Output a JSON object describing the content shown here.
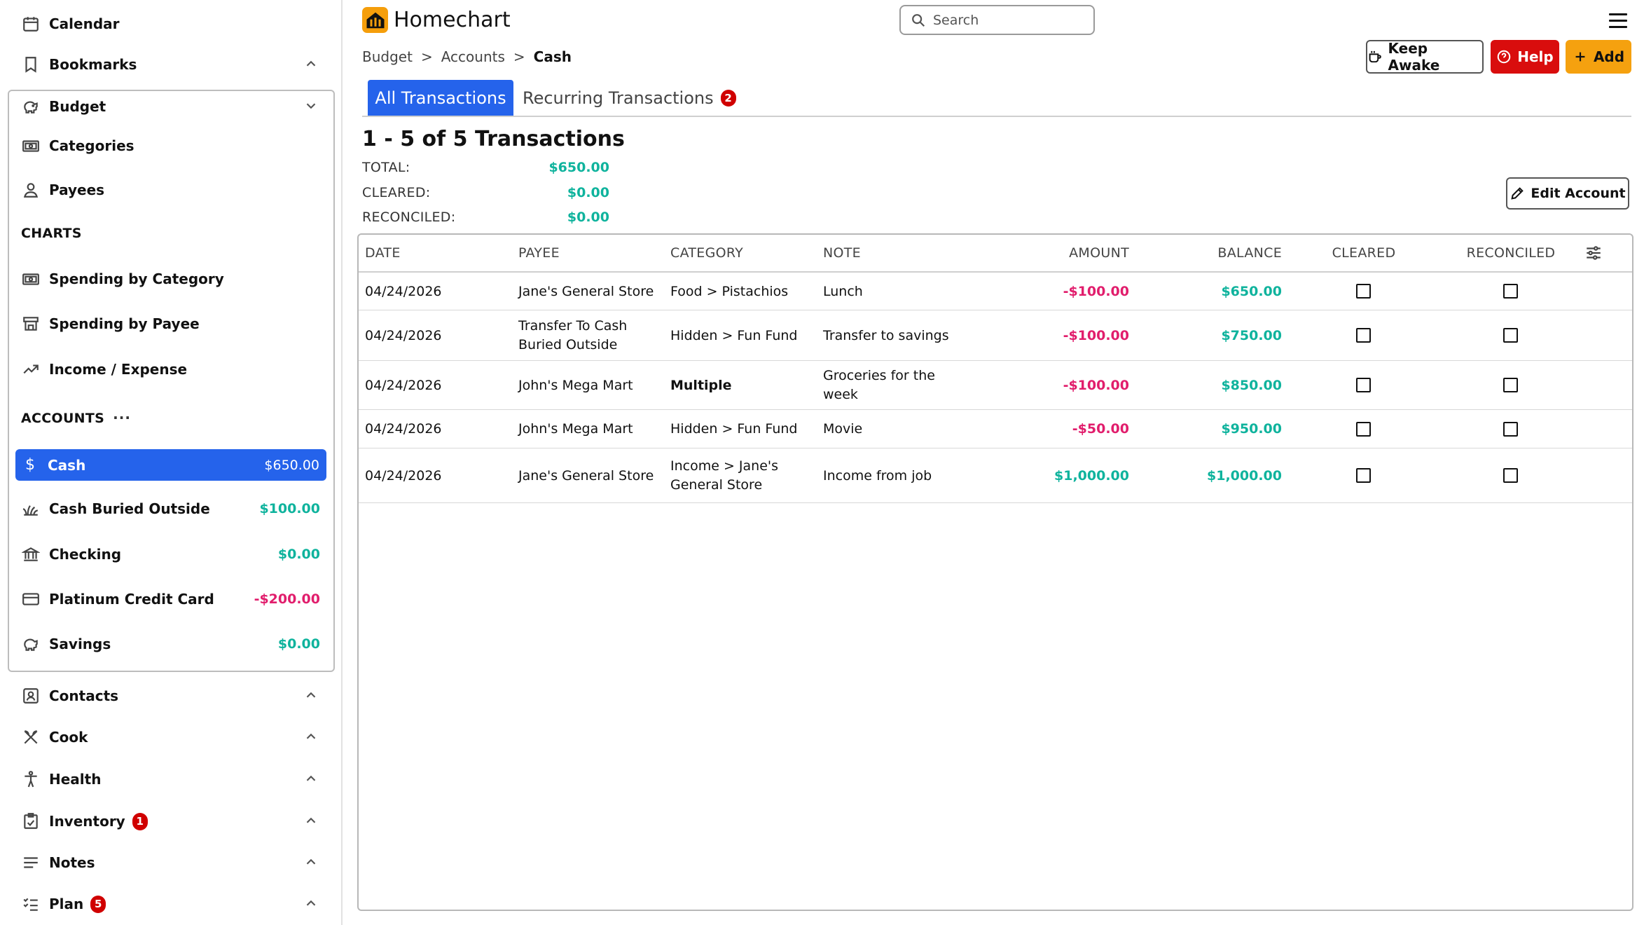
{
  "app": {
    "title": "Homechart"
  },
  "search": {
    "placeholder": "Search"
  },
  "sidebar": {
    "top_items": [
      {
        "label": "Calendar",
        "icon": "calendar-icon"
      },
      {
        "label": "Bookmarks",
        "icon": "bookmark-icon"
      }
    ],
    "budget": {
      "label": "Budget",
      "items": [
        {
          "label": "Categories",
          "icon": "categories-icon"
        },
        {
          "label": "Payees",
          "icon": "payee-icon"
        }
      ],
      "charts_title": "CHARTS",
      "charts": [
        {
          "label": "Spending by Category",
          "icon": "chart-category-icon"
        },
        {
          "label": "Spending by Payee",
          "icon": "store-icon"
        },
        {
          "label": "Income / Expense",
          "icon": "trend-icon"
        }
      ],
      "accounts_title": "ACCOUNTS",
      "accounts_more": "···",
      "accounts": [
        {
          "label": "Cash",
          "amount": "$650.00",
          "amount_color": "#ffffff",
          "icon": "dollar-icon",
          "active": true
        },
        {
          "label": "Cash Buried Outside",
          "amount": "$100.00",
          "amount_color": "#0fb39d",
          "icon": "grass-icon"
        },
        {
          "label": "Checking",
          "amount": "$0.00",
          "amount_color": "#0fb39d",
          "icon": "bank-icon"
        },
        {
          "label": "Platinum Credit Card",
          "amount": "-$200.00",
          "amount_color": "#e11d6c",
          "icon": "credit-card-icon"
        },
        {
          "label": "Savings",
          "amount": "$0.00",
          "amount_color": "#0fb39d",
          "icon": "piggy-bank-icon"
        }
      ]
    },
    "bottom_items": [
      {
        "label": "Contacts",
        "icon": "contacts-icon",
        "badge": ""
      },
      {
        "label": "Cook",
        "icon": "cook-icon",
        "badge": ""
      },
      {
        "label": "Health",
        "icon": "health-icon",
        "badge": ""
      },
      {
        "label": "Inventory",
        "icon": "inventory-icon",
        "badge": "1"
      },
      {
        "label": "Notes",
        "icon": "notes-icon",
        "badge": ""
      },
      {
        "label": "Plan",
        "icon": "plan-icon",
        "badge": "5"
      }
    ]
  },
  "breadcrumb": {
    "items": [
      "Budget",
      "Accounts",
      "Cash"
    ],
    "separator": ">"
  },
  "toolbar": {
    "keep_awake": "Keep Awake",
    "help": "Help",
    "add": "Add"
  },
  "tabs": [
    {
      "label": "All Transactions",
      "active": true
    },
    {
      "label": "Recurring Transactions",
      "badge": "2"
    }
  ],
  "summary": {
    "title": "1 - 5 of 5 Transactions",
    "rows": [
      {
        "label": "TOTAL:",
        "value": "$650.00"
      },
      {
        "label": "CLEARED:",
        "value": "$0.00"
      },
      {
        "label": "RECONCILED:",
        "value": "$0.00"
      }
    ],
    "edit_account": "Edit Account"
  },
  "table": {
    "columns": [
      "DATE",
      "PAYEE",
      "CATEGORY",
      "NOTE",
      "AMOUNT",
      "BALANCE",
      "CLEARED",
      "RECONCILED"
    ],
    "rows": [
      {
        "date": "04/24/2026",
        "payee": [
          "Jane's General Store"
        ],
        "category": [
          "Food > Pistachios"
        ],
        "category_bold": false,
        "note": [
          "Lunch"
        ],
        "amount": "-$100.00",
        "amount_color": "#e11d6c",
        "balance": "$650.00",
        "cleared": false,
        "reconciled": false
      },
      {
        "date": "04/24/2026",
        "payee": [
          "Transfer To Cash",
          "Buried Outside"
        ],
        "category": [
          "Hidden > Fun Fund"
        ],
        "category_bold": false,
        "note": [
          "Transfer to savings"
        ],
        "amount": "-$100.00",
        "amount_color": "#e11d6c",
        "balance": "$750.00",
        "cleared": false,
        "reconciled": false
      },
      {
        "date": "04/24/2026",
        "payee": [
          "John's Mega Mart"
        ],
        "category": [
          "Multiple"
        ],
        "category_bold": true,
        "note": [
          "Groceries for the",
          "week"
        ],
        "amount": "-$100.00",
        "amount_color": "#e11d6c",
        "balance": "$850.00",
        "cleared": false,
        "reconciled": false
      },
      {
        "date": "04/24/2026",
        "payee": [
          "John's Mega Mart"
        ],
        "category": [
          "Hidden > Fun Fund"
        ],
        "category_bold": false,
        "note": [
          "Movie"
        ],
        "amount": "-$50.00",
        "amount_color": "#e11d6c",
        "balance": "$950.00",
        "cleared": false,
        "reconciled": false
      },
      {
        "date": "04/24/2026",
        "payee": [
          "Jane's General Store"
        ],
        "category": [
          "Income > Jane's",
          "General Store"
        ],
        "category_bold": false,
        "note": [
          "Income from job"
        ],
        "amount": "$1,000.00",
        "amount_color": "#0fb39d",
        "balance": "$1,000.00",
        "cleared": false,
        "reconciled": false
      }
    ]
  },
  "colors": {
    "accent": "#2563eb",
    "brand": "#f5a10f",
    "danger": "#d90d0d",
    "positive": "#0fb39d",
    "negative": "#e11d6c"
  }
}
